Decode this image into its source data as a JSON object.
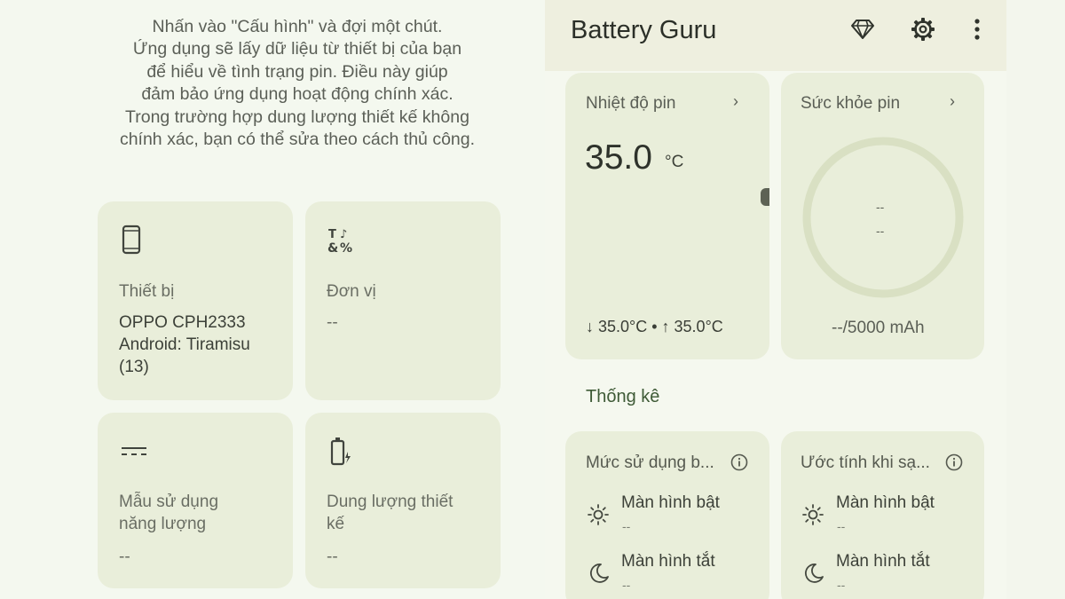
{
  "intro": {
    "lines": [
      "Nhấn vào \"Cấu hình\" và đợi một chút.",
      "Ứng dụng sẽ lấy dữ liệu từ thiết bị của bạn",
      "để hiểu về tình trạng pin. Điều này giúp",
      "đảm bảo ứng dụng hoạt động chính xác.",
      "Trong trường hợp dung lượng thiết kế không",
      "chính xác, bạn có thể sửa theo cách thủ công."
    ]
  },
  "config_cards": {
    "device": {
      "icon": "phone-icon",
      "label": "Thiết bị",
      "value": "OPPO CPH2333\nAndroid: Tiramisu\n(13)"
    },
    "units": {
      "icon": "units-icon",
      "label": "Đơn vị",
      "value": "--"
    },
    "power_profile": {
      "icon": "power-profile-icon",
      "label": "Mẫu sử dụng\nnăng lượng",
      "value": "--"
    },
    "design_capacity": {
      "icon": "battery-charging-icon",
      "label": "Dung lượng thiết\nkế",
      "value": "--"
    }
  },
  "appbar": {
    "title": "Battery Guru",
    "icons": [
      "diamond-icon",
      "gear-icon",
      "more-vert-icon"
    ]
  },
  "temperature_card": {
    "title": "Nhiệt độ pin",
    "chevron": "›",
    "value": "35.0",
    "unit": "°C",
    "min_max": "↓ 35.0°C • ↑ 35.0°C"
  },
  "health_card": {
    "title": "Sức khỏe pin",
    "chevron": "›",
    "line1": "--",
    "line2": "--",
    "capacity": "--/5000 mAh"
  },
  "stats": {
    "section_title": "Thống kê",
    "usage_card": {
      "title": "Mức sử dụng b...",
      "screen_on_label": "Màn hình bật",
      "screen_on_value": "--",
      "screen_off_label": "Màn hình tắt",
      "screen_off_value": "--"
    },
    "charge_card": {
      "title": "Ước tính khi sạ...",
      "screen_on_label": "Màn hình bật",
      "screen_on_value": "--",
      "screen_off_label": "Màn hình tắt",
      "screen_off_value": "--"
    }
  },
  "colors": {
    "background": "#f3f6ed",
    "card": "#e9eeda",
    "appbar": "#eeefdf",
    "ring": "#d9e0c3",
    "accent_text": "#3e5a36"
  }
}
